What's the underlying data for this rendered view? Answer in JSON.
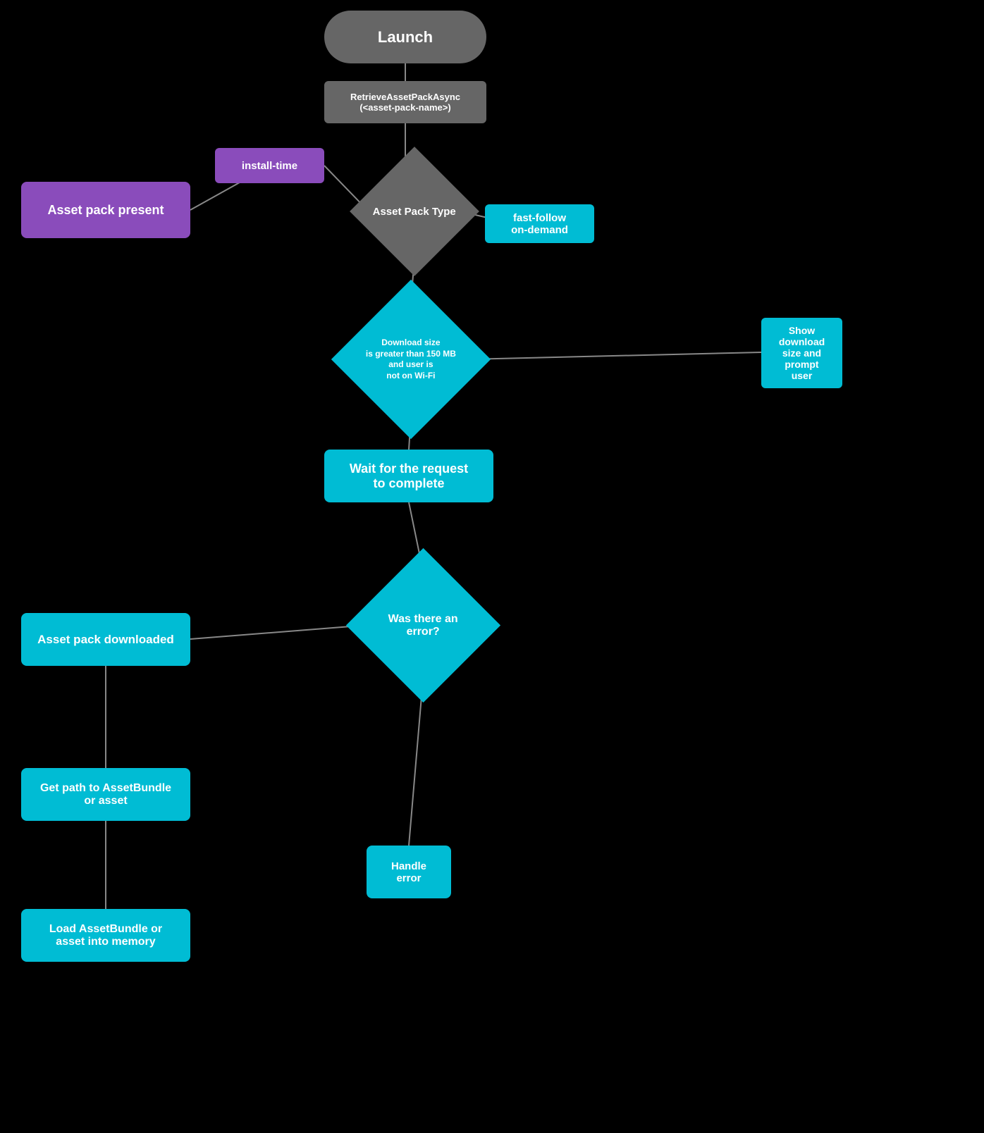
{
  "nodes": {
    "launch": {
      "label": "Launch"
    },
    "retrieve": {
      "line1": "RetrieveAssetPackAsync",
      "line2": "(<asset-pack-name>)"
    },
    "asset_pack_type": {
      "label": "Asset Pack Type"
    },
    "install_time": {
      "label": "install-time"
    },
    "asset_pack_present": {
      "label": "Asset pack present"
    },
    "fast_follow": {
      "label": "fast-follow\non-demand"
    },
    "download_size_diamond": {
      "label": "Download size\nis greater than 150 MB\nand user is\nnot on Wi-Fi"
    },
    "show_download": {
      "label": "Show download size and prompt user"
    },
    "wait": {
      "label": "Wait for the request to complete"
    },
    "was_error": {
      "label": "Was there an error?"
    },
    "asset_pack_downloaded": {
      "label": "Asset pack downloaded"
    },
    "get_path": {
      "label": "Get path to AssetBundle or asset"
    },
    "load_assetbundle": {
      "label": "Load AssetBundle or asset into memory"
    },
    "handle_error": {
      "label": "Handle error"
    }
  },
  "colors": {
    "dark_gray": "#666666",
    "purple": "#8a4cbb",
    "teal": "#00bcd4",
    "black": "#000000",
    "white": "#ffffff"
  }
}
